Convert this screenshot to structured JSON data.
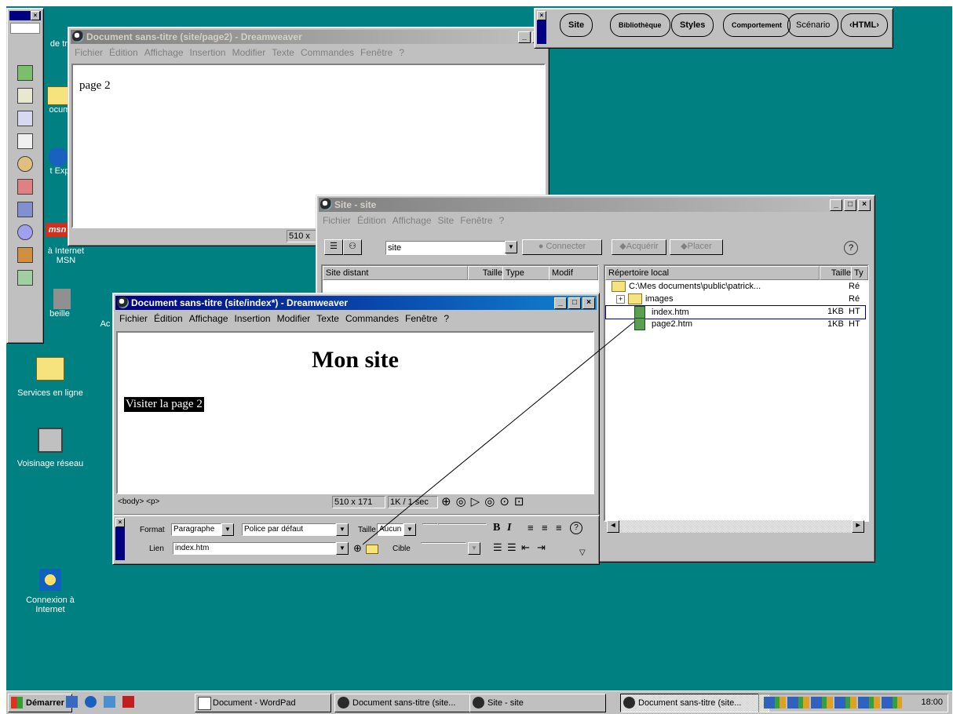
{
  "desktop_icons": [
    {
      "label": "de tra"
    },
    {
      "label": "ocum"
    },
    {
      "label": "t Exp"
    },
    {
      "label": "à Internet\nMSN"
    },
    {
      "label": "beille"
    },
    {
      "label": "Ac"
    },
    {
      "label": "Services en ligne"
    },
    {
      "label": "Voisinage réseau"
    },
    {
      "label": "Connexion à\nInternet"
    }
  ],
  "doc2": {
    "title": "Document sans-titre (site/page2) - Dreamweaver",
    "menu": [
      "Fichier",
      "Édition",
      "Affichage",
      "Insertion",
      "Modifier",
      "Texte",
      "Commandes",
      "Fenêtre",
      "?"
    ],
    "content": "page 2",
    "status": "510 x"
  },
  "assets": {
    "tabs": [
      "Site",
      "Bibliothèque",
      "Styles",
      "Comportement",
      "Scénario",
      "‹HTML›"
    ]
  },
  "site": {
    "title": "Site - site",
    "menu": [
      "Fichier",
      "Édition",
      "Affichage",
      "Site",
      "Fenêtre",
      "?"
    ],
    "site_select": "site",
    "connect": "Connecter",
    "get": "Acquérir",
    "put": "Placer",
    "help": "?",
    "remote_headers": [
      "Site distant",
      "Taille",
      "Type",
      "Modif"
    ],
    "local_headers": [
      "Répertoire local",
      "Taille",
      "Ty"
    ],
    "local_rows": [
      {
        "name": "C:\\Mes documents\\public\\patrick...",
        "size": "",
        "type": "Ré"
      },
      {
        "name": "images",
        "size": "",
        "type": "Ré"
      },
      {
        "name": "index.htm",
        "size": "1KB",
        "type": "HT"
      },
      {
        "name": "page2.htm",
        "size": "1KB",
        "type": "HT"
      }
    ]
  },
  "doc1": {
    "title": "Document sans-titre (site/index*) - Dreamweaver",
    "menu": [
      "Fichier",
      "Édition",
      "Affichage",
      "Insertion",
      "Modifier",
      "Texte",
      "Commandes",
      "Fenêtre",
      "?"
    ],
    "heading": "Mon site",
    "link_text": "Visiter la page 2",
    "tag_selector": "<body> <p>",
    "size": "510 x 171",
    "weight": "1K / 1 sec"
  },
  "props": {
    "format_label": "Format",
    "format_value": "Paragraphe",
    "font_value": "Police par défaut",
    "size_label": "Taille",
    "size_value": "Aucun",
    "bold": "B",
    "italic": "I",
    "link_label": "Lien",
    "link_value": "index.htm",
    "target_label": "Cible"
  },
  "taskbar": {
    "start": "Démarrer",
    "tasks": [
      "Document - WordPad",
      "Document sans-titre (site...",
      "Site - site",
      "Document sans-titre (site..."
    ],
    "clock": "18:00"
  }
}
